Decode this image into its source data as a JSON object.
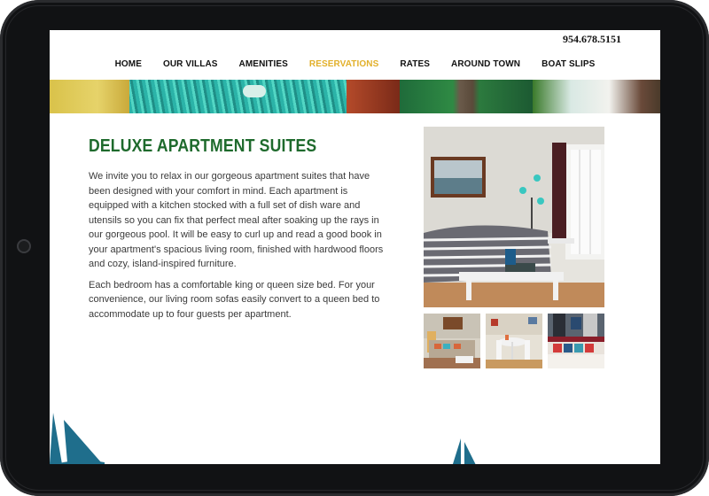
{
  "header": {
    "phone": "954.678.5151"
  },
  "nav": {
    "items": [
      {
        "label": "HOME",
        "active": false
      },
      {
        "label": "OUR VILLAS",
        "active": false
      },
      {
        "label": "AMENITIES",
        "active": false
      },
      {
        "label": "RESERVATIONS",
        "active": true
      },
      {
        "label": "RATES",
        "active": false
      },
      {
        "label": "AROUND TOWN",
        "active": false
      },
      {
        "label": "BOAT SLIPS",
        "active": false
      }
    ]
  },
  "main": {
    "heading": "DELUXE APARTMENT SUITES",
    "paragraphs": [
      "We invite you to relax in our gorgeous apartment suites that have been designed with your comfort in mind. Each apartment is equipped with a kitchen stocked with a full set of dish ware and utensils so you can fix that perfect meal after soaking up the rays in our gorgeous pool. It will be easy to curl up and read a good book in your apartment's spacious living room, finished with hardwood floors and cozy, island-inspired furniture.",
      "Each bedroom has a comfortable king or queen size bed. For your convenience, our living room sofas easily convert to a queen bed to accommodate up to four guests per apartment."
    ]
  },
  "colors": {
    "active_nav": "#e2b02a",
    "heading_green": "#1e6a2c",
    "sail_blue": "#1f6e8c",
    "device_bezel": "#111214"
  }
}
